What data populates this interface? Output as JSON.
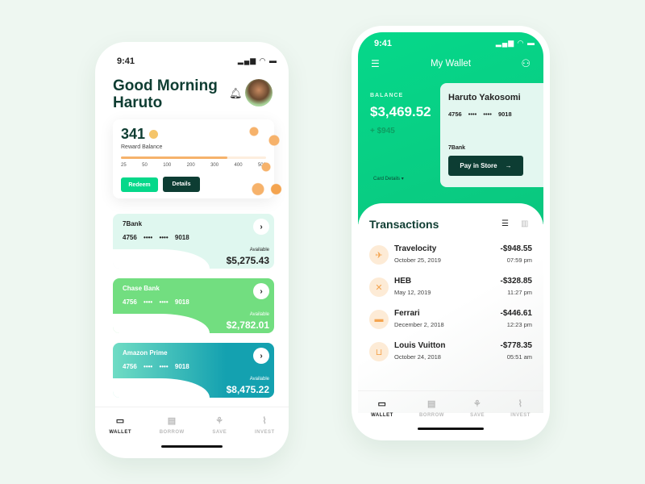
{
  "colors": {
    "accent": "#05d88a",
    "dark": "#0f3d32",
    "coin": "#f6b26b"
  },
  "phone1": {
    "time": "9:41",
    "greeting": "Good Morning Haruto",
    "reward": {
      "points": "341",
      "label": "Reward Balance",
      "progress_value": 340,
      "ticks": [
        "25",
        "50",
        "100",
        "200",
        "300",
        "400",
        "500"
      ],
      "redeem": "Redeem",
      "details": "Details"
    },
    "cards": [
      {
        "bank": "7Bank",
        "number": "4756 •••• •••• 9018",
        "available": "Available",
        "amount": "$5,275.43"
      },
      {
        "bank": "Chase Bank",
        "number": "4756 •••• •••• 9018",
        "available": "Available",
        "amount": "$2,782.01"
      },
      {
        "bank": "Amazon Prime",
        "number": "4756 •••• •••• 9018",
        "available": "Available",
        "amount": "$8,475.22"
      }
    ],
    "nav": [
      {
        "label": "WALLET",
        "icon": "wallet-icon",
        "active": true
      },
      {
        "label": "BORROW",
        "icon": "borrow-icon"
      },
      {
        "label": "SAVE",
        "icon": "save-icon"
      },
      {
        "label": "INVEST",
        "icon": "invest-icon"
      }
    ]
  },
  "phone2": {
    "time": "9:41",
    "title": "My Wallet",
    "balance_label": "BALANCE",
    "balance": "$3,469.52",
    "change": "+ $945",
    "card_details": "Card Details",
    "card": {
      "holder": "Haruto Yakosomi",
      "number": "4756 •••• •••• 9018",
      "bank": "7Bank",
      "pay": "Pay in Store"
    },
    "transactions_title": "Transactions",
    "transactions": [
      {
        "merchant": "Travelocity",
        "date": "October 25, 2019",
        "amount": "-$948.55",
        "time": "07:59 pm",
        "icon": "plane-icon"
      },
      {
        "merchant": "HEB",
        "date": "May 12, 2019",
        "amount": "-$328.85",
        "time": "11:27 pm",
        "icon": "utensils-icon"
      },
      {
        "merchant": "Ferrari",
        "date": "December 2, 2018",
        "amount": "-$446.61",
        "time": "12:23 pm",
        "icon": "car-icon"
      },
      {
        "merchant": "Louis Vuitton",
        "date": "October 24, 2018",
        "amount": "-$778.35",
        "time": "05:51 am",
        "icon": "cart-icon"
      }
    ],
    "nav": [
      {
        "label": "WALLET"
      },
      {
        "label": "BORROW"
      },
      {
        "label": "SAVE"
      },
      {
        "label": "INVEST"
      }
    ]
  }
}
